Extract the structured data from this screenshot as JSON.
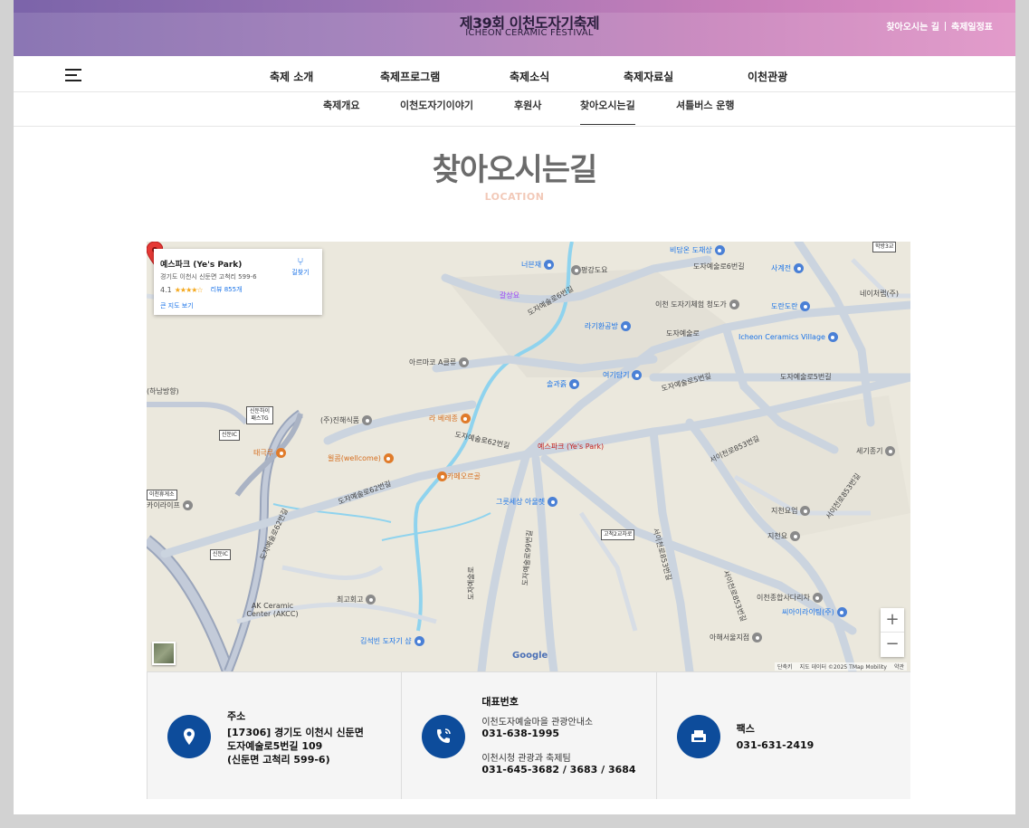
{
  "header": {
    "logo_kr": "제39회 이천도자기축제",
    "logo_en": "ICHEON CERAMIC FESTIVAL",
    "util_links": [
      "찾아오시는 길",
      "축제일정표"
    ]
  },
  "gnb": [
    "축제 소개",
    "축제프로그램",
    "축제소식",
    "축제자료실",
    "이천관광"
  ],
  "lnb": {
    "items": [
      "축제개요",
      "이천도자기이야기",
      "후원사",
      "찾아오시는길",
      "셔틀버스 운행"
    ],
    "active": "찾아오시는길"
  },
  "page": {
    "title": "찾아오시는길",
    "subtitle": "LOCATION"
  },
  "map": {
    "card": {
      "title": "예스파크 (Ye's Park)",
      "address": "경기도 이천시 신둔면 고척리 599-6",
      "rating": "4.1",
      "stars": "★★★★☆",
      "reviews": "리뷰 855개",
      "bigmap": "큰 지도 보기",
      "directions": "길찾기"
    },
    "marker_label": "예스파크 (Ye's Park)",
    "labels": [
      {
        "text": "너븐재",
        "cls": "blue",
        "pin": "b"
      },
      {
        "text": "평강도요",
        "cls": "",
        "pin": "g"
      },
      {
        "text": "비담온 도채상",
        "cls": "blue",
        "pin": "b"
      },
      {
        "text": "도자예술로6번길",
        "cls": "",
        "pin": ""
      },
      {
        "text": "사계전",
        "cls": "blue",
        "pin": "b"
      },
      {
        "text": "도자예술로6번길",
        "cls": "",
        "pin": ""
      },
      {
        "text": "네이처랩(주)",
        "cls": "",
        "pin": "g"
      },
      {
        "text": "갈상요",
        "cls": "purple",
        "pin": "p"
      },
      {
        "text": "이천 도자기체험 청도가",
        "cls": "",
        "pin": "g"
      },
      {
        "text": "도란도란",
        "cls": "blue",
        "pin": "b"
      },
      {
        "text": "라기환공방",
        "cls": "blue",
        "pin": "b"
      },
      {
        "text": "도자예술로",
        "cls": "",
        "pin": ""
      },
      {
        "text": "Icheon Ceramics Village",
        "cls": "blue",
        "pin": "b"
      },
      {
        "text": "아르마코 A클류",
        "cls": "",
        "pin": "g"
      },
      {
        "text": "여기담기",
        "cls": "blue",
        "pin": "b"
      },
      {
        "text": "도자예술로5번길",
        "cls": "",
        "pin": ""
      },
      {
        "text": "도자예술로5번길",
        "cls": "",
        "pin": ""
      },
      {
        "text": "솔과흙",
        "cls": "blue",
        "pin": "b"
      },
      {
        "text": "(하남방향)",
        "cls": "",
        "pin": ""
      },
      {
        "text": "(주)진해식품",
        "cls": "",
        "pin": "g"
      },
      {
        "text": "라 베레종",
        "cls": "orange",
        "pin": "o"
      },
      {
        "text": "태극루",
        "cls": "orange",
        "pin": "o"
      },
      {
        "text": "윌콤(wellcome)",
        "cls": "orange",
        "pin": "o"
      },
      {
        "text": "도자예술로62번길",
        "cls": "",
        "pin": ""
      },
      {
        "text": "카페오르골",
        "cls": "orange",
        "pin": "o"
      },
      {
        "text": "세기종기",
        "cls": "",
        "pin": "g"
      },
      {
        "text": "서이천로853번길",
        "cls": "",
        "pin": ""
      },
      {
        "text": "그릇세상 아울렛",
        "cls": "blue",
        "pin": "b"
      },
      {
        "text": "도자예술로62번길",
        "cls": "",
        "pin": ""
      },
      {
        "text": "카이라이프",
        "cls": "",
        "pin": "g"
      },
      {
        "text": "지천요업",
        "cls": "",
        "pin": "g"
      },
      {
        "text": "지천요",
        "cls": "",
        "pin": "g"
      },
      {
        "text": "AK Ceramic Center (AKCC)",
        "cls": "",
        "pin": "g"
      },
      {
        "text": "최고회고",
        "cls": "",
        "pin": "g"
      },
      {
        "text": "이천종합사다리차",
        "cls": "",
        "pin": "g"
      },
      {
        "text": "씨아이라이팅(주)",
        "cls": "blue",
        "pin": "b"
      },
      {
        "text": "김석빈 도자기 샵",
        "cls": "blue",
        "pin": "b"
      },
      {
        "text": "아해서울지점",
        "cls": "",
        "pin": "g"
      },
      {
        "text": "도자예술로62번길",
        "cls": "",
        "pin": ""
      },
      {
        "text": "서이천로853번길",
        "cls": "",
        "pin": ""
      },
      {
        "text": "서이천로853번길",
        "cls": "",
        "pin": ""
      },
      {
        "text": "도자예술로99번길",
        "cls": "",
        "pin": ""
      },
      {
        "text": "도자예술로",
        "cls": "",
        "pin": ""
      },
      {
        "text": "서이천로853번길",
        "cls": "",
        "pin": ""
      }
    ],
    "signs": [
      "신둔하이 패스TG",
      "신둔IC",
      "이천휴게소",
      "신둔IC",
      "고척2교차로",
      "학방3교"
    ],
    "google": "Google",
    "attribution": [
      "단축키",
      "지도 데이터 ©2025 TMap Mobility",
      "약관"
    ],
    "zoom_in": "+",
    "zoom_out": "−"
  },
  "info": {
    "address": {
      "title": "주소",
      "lines": [
        "[17306] 경기도 이천시 신둔면",
        "도자예술로5번길 109",
        "(신둔면 고척리 599-6)"
      ]
    },
    "phone": {
      "title": "대표번호",
      "sub1": "이천도자예술마을 관광안내소",
      "num1": "031-638-1995",
      "sub2": "이천시청 관광과 축제팀",
      "num2": "031-645-3682 / 3683 / 3684"
    },
    "fax": {
      "title": "팩스",
      "num": "031-631-2419"
    }
  },
  "colors": {
    "accent": "#0d4c9b",
    "title_gray": "#6b6b6b",
    "subtitle_peach": "#f2c9b8"
  }
}
